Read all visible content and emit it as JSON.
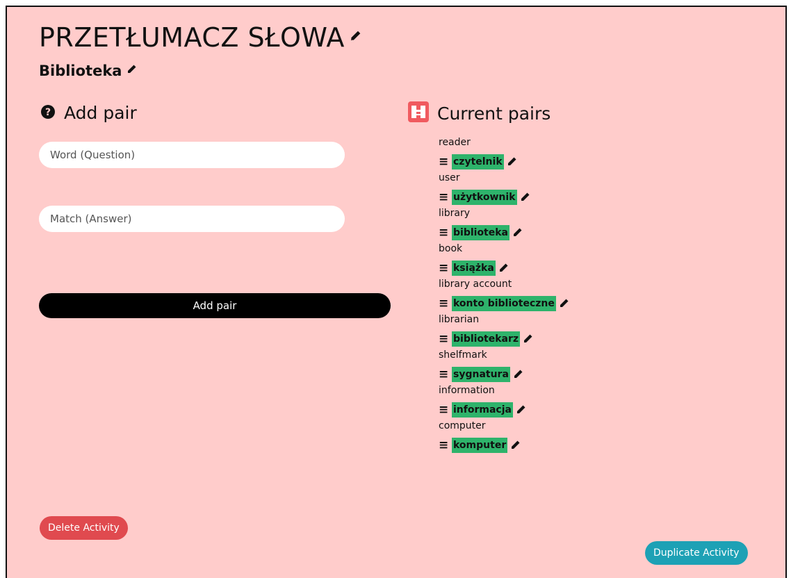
{
  "activity": {
    "title": "PRZETŁUMACZ SŁOWA",
    "subtitle": "Biblioteka"
  },
  "add_pair": {
    "heading": "Add pair",
    "word_placeholder": "Word (Question)",
    "match_placeholder": "Match (Answer)",
    "button_label": "Add pair"
  },
  "current_pairs": {
    "heading": "Current pairs",
    "pairs": [
      {
        "question": "reader",
        "answer": "czytelnik"
      },
      {
        "question": "user",
        "answer": "użytkownik"
      },
      {
        "question": "library",
        "answer": "biblioteka"
      },
      {
        "question": "book",
        "answer": "książka"
      },
      {
        "question": "library account",
        "answer": "konto biblioteczne"
      },
      {
        "question": "librarian",
        "answer": "bibliotekarz"
      },
      {
        "question": "shelfmark",
        "answer": "sygnatura"
      },
      {
        "question": "information",
        "answer": "informacja"
      },
      {
        "question": "computer",
        "answer": "komputer"
      }
    ]
  },
  "actions": {
    "delete_label": "Delete Activity",
    "duplicate_label": "Duplicate Activity"
  },
  "colors": {
    "background": "#ffcccb",
    "answer_highlight": "#2eb36b",
    "delete": "#e04a4f",
    "duplicate": "#1da1b5"
  },
  "icons": {
    "edit": "pencil-icon",
    "help": "question-circle-icon",
    "pairs": "puzzle-icon",
    "drag": "drag-handle-icon"
  }
}
